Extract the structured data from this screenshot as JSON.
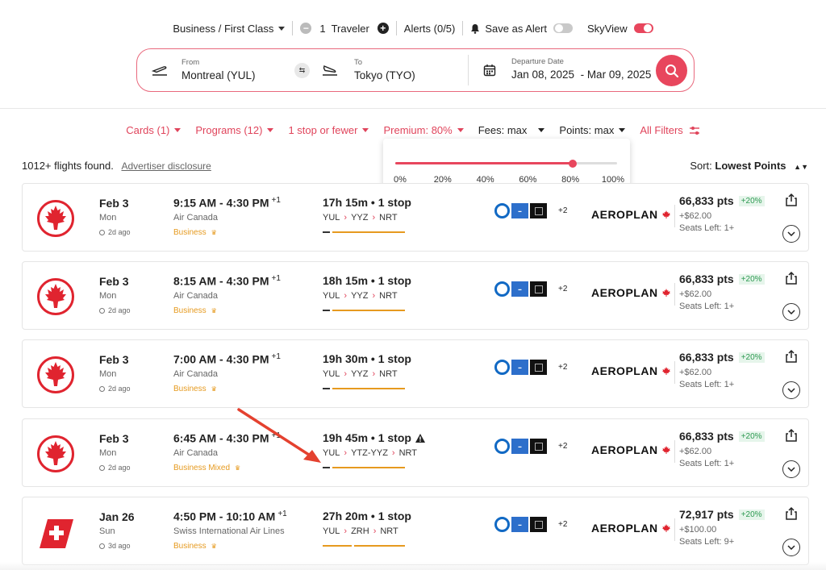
{
  "topbar": {
    "cabin": "Business / First Class",
    "travelers": "1  Traveler",
    "alerts": "Alerts (0/5)",
    "save_alert": "Save as Alert",
    "save_alert_on": false,
    "skyview": "SkyView",
    "skyview_on": true
  },
  "search": {
    "from_label": "From",
    "from_value": "Montreal (YUL)",
    "to_label": "To",
    "to_value": "Tokyo (TYO)",
    "date_label": "Departure Date",
    "date_value": "Jan 08, 2025  - Mar 09, 2025"
  },
  "filters": [
    {
      "label": "Cards (1)",
      "active": true
    },
    {
      "label": "Programs (12)",
      "active": true
    },
    {
      "label": "1 stop or fewer",
      "active": true
    },
    {
      "label": "Premium: 80%",
      "active": true
    },
    {
      "label": "Fees: max",
      "active": false
    },
    {
      "label": "Points: max",
      "active": false
    },
    {
      "label": "All Filters",
      "active": true
    }
  ],
  "premium_slider": {
    "value_percent": 80,
    "ticks": [
      "0%",
      "20%",
      "40%",
      "60%",
      "80%",
      "100%"
    ]
  },
  "results": {
    "count": "1012+ flights found.",
    "disclosure": "Advertiser disclosure",
    "sort_label": "Sort:",
    "sort_value": "Lowest Points"
  },
  "flights": [
    {
      "airline_logo": "air-canada-logo",
      "date": "Feb 3",
      "dow": "Mon",
      "ago": "2d ago",
      "times": "9:15 AM - 4:30 PM",
      "day_offset": "+1",
      "airline": "Air Canada",
      "cabin": "Business",
      "duration": "17h 15m • 1 stop",
      "warning": false,
      "route": [
        "YUL",
        "YYZ",
        "NRT"
      ],
      "program": "AEROPLAN",
      "cards_more": "+2",
      "points": "66,833 pts",
      "bonus": "+20%",
      "fee": "+$62.00",
      "seats": "Seats Left: 1+"
    },
    {
      "airline_logo": "air-canada-logo",
      "date": "Feb 3",
      "dow": "Mon",
      "ago": "2d ago",
      "times": "8:15 AM - 4:30 PM",
      "day_offset": "+1",
      "airline": "Air Canada",
      "cabin": "Business",
      "duration": "18h 15m • 1 stop",
      "warning": false,
      "route": [
        "YUL",
        "YYZ",
        "NRT"
      ],
      "program": "AEROPLAN",
      "cards_more": "+2",
      "points": "66,833 pts",
      "bonus": "+20%",
      "fee": "+$62.00",
      "seats": "Seats Left: 1+"
    },
    {
      "airline_logo": "air-canada-logo",
      "date": "Feb 3",
      "dow": "Mon",
      "ago": "2d ago",
      "times": "7:00 AM - 4:30 PM",
      "day_offset": "+1",
      "airline": "Air Canada",
      "cabin": "Business",
      "duration": "19h 30m • 1 stop",
      "warning": false,
      "route": [
        "YUL",
        "YYZ",
        "NRT"
      ],
      "program": "AEROPLAN",
      "cards_more": "+2",
      "points": "66,833 pts",
      "bonus": "+20%",
      "fee": "+$62.00",
      "seats": "Seats Left: 1+"
    },
    {
      "airline_logo": "air-canada-logo",
      "date": "Feb 3",
      "dow": "Mon",
      "ago": "2d ago",
      "times": "6:45 AM - 4:30 PM",
      "day_offset": "+1",
      "airline": "Air Canada",
      "cabin": "Business Mixed",
      "duration": "19h 45m • 1 stop",
      "warning": true,
      "route": [
        "YUL",
        "YTZ-YYZ",
        "NRT"
      ],
      "program": "AEROPLAN",
      "cards_more": "+2",
      "points": "66,833 pts",
      "bonus": "+20%",
      "fee": "+$62.00",
      "seats": "Seats Left: 1+"
    },
    {
      "airline_logo": "swiss-logo",
      "date": "Jan 26",
      "dow": "Sun",
      "ago": "3d ago",
      "times": "4:50 PM - 10:10 AM",
      "day_offset": "+1",
      "airline": "Swiss International Air Lines",
      "cabin": "Business",
      "duration": "27h 20m • 1 stop",
      "warning": false,
      "route": [
        "YUL",
        "ZRH",
        "NRT"
      ],
      "program": "AEROPLAN",
      "cards_more": "+2",
      "points": "72,917 pts",
      "bonus": "+20%",
      "fee": "+$100.00",
      "seats": "Seats Left: 9+"
    }
  ],
  "colors": {
    "accent": "#e8465d",
    "cabin": "#e69a1f",
    "bonus_text": "#2e9a52",
    "annotation_arrow": "#e4412f"
  }
}
